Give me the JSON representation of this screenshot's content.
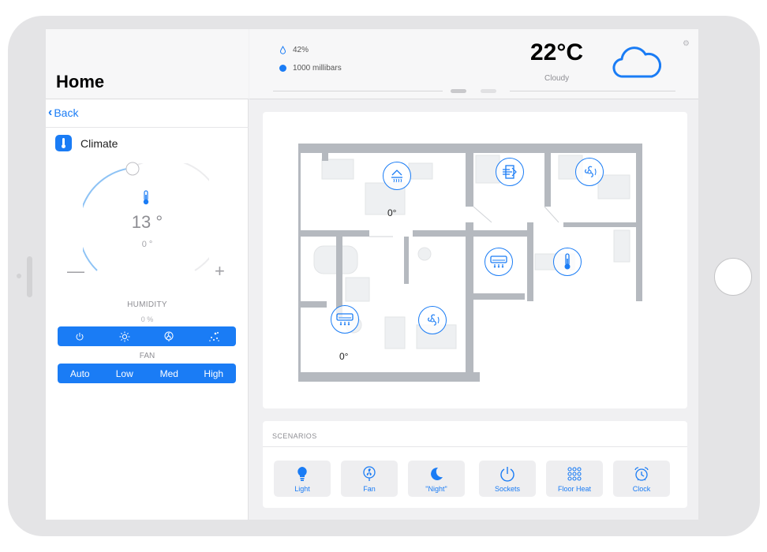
{
  "sidebar": {
    "title": "Home",
    "back_label": "Back",
    "section_label": "Climate",
    "temperature": "13 °",
    "setpoint": "0 °",
    "minus_label": "—",
    "plus_label": "+",
    "humidity_label": "HUMIDITY",
    "humidity_value": "0 %",
    "modes": [
      "power",
      "heat-sun",
      "fan",
      "snowflake"
    ],
    "fan_label": "FAN",
    "fan_options": [
      "Auto",
      "Low",
      "Med",
      "High"
    ]
  },
  "weather": {
    "humidity": "42%",
    "pressure": "1000 millibars",
    "temperature": "22°C",
    "condition": "Cloudy",
    "icon": "cloud-icon"
  },
  "plan": {
    "devices": [
      {
        "name": "floor-heat-device",
        "icon": "floor-heat-icon",
        "value": "0°"
      },
      {
        "name": "vent-device",
        "icon": "vent-icon",
        "value": ""
      },
      {
        "name": "fan-device-top",
        "icon": "fan-icon",
        "value": ""
      },
      {
        "name": "ac-device-center",
        "icon": "ac-icon",
        "value": ""
      },
      {
        "name": "thermometer-device",
        "icon": "thermometer-icon",
        "value": ""
      },
      {
        "name": "ac-device-left",
        "icon": "ac-icon",
        "value": "0°"
      },
      {
        "name": "fan-device-bottom",
        "icon": "fan-icon",
        "value": ""
      }
    ]
  },
  "scenarios": {
    "title": "SCENARIOS",
    "items": [
      {
        "label": "Light",
        "icon": "bulb-icon"
      },
      {
        "label": "Fan",
        "icon": "fan-icon"
      },
      {
        "label": "\"Night\"",
        "icon": "moon-icon"
      },
      {
        "label": "Sockets",
        "icon": "power-icon"
      },
      {
        "label": "Floor Heat",
        "icon": "dots-grid-icon"
      },
      {
        "label": "Clock",
        "icon": "alarm-clock-icon"
      }
    ]
  },
  "colors": {
    "accent": "#1a7cf5",
    "sidebar_bg": "#ffffff",
    "screen_bg": "#f0f0f2"
  }
}
